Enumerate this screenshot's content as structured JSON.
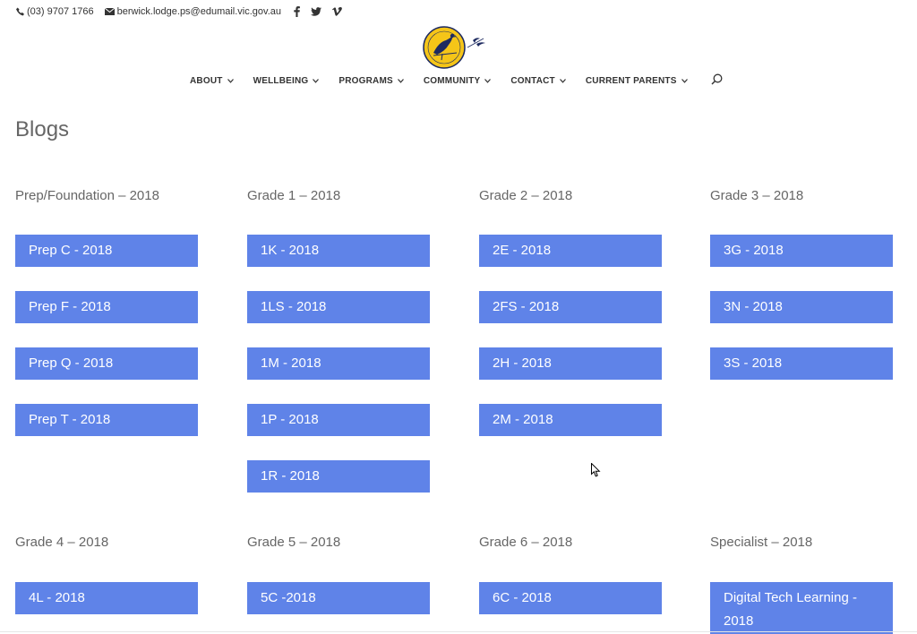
{
  "topbar": {
    "phone": "(03) 9707 1766",
    "email": "berwick.lodge.ps@edumail.vic.gov.au",
    "social": [
      "facebook-icon",
      "twitter-icon",
      "vimeo-icon"
    ]
  },
  "nav": {
    "items": [
      "ABOUT",
      "WELLBEING",
      "PROGRAMS",
      "COMMUNITY",
      "CONTACT",
      "CURRENT PARENTS"
    ]
  },
  "page": {
    "title": "Blogs"
  },
  "sections": [
    {
      "title": "Prep/Foundation – 2018",
      "buttons": [
        "Prep C - 2018",
        "Prep F - 2018",
        "Prep Q - 2018",
        "Prep T - 2018"
      ]
    },
    {
      "title": "Grade 1 – 2018",
      "buttons": [
        "1K - 2018",
        "1LS - 2018",
        "1M - 2018",
        "1P - 2018",
        "1R - 2018"
      ]
    },
    {
      "title": "Grade 2 – 2018",
      "buttons": [
        "2E - 2018",
        "2FS - 2018",
        "2H - 2018",
        "2M - 2018"
      ]
    },
    {
      "title": "Grade 3 – 2018",
      "buttons": [
        "3G - 2018",
        "3N - 2018",
        "3S - 2018"
      ]
    },
    {
      "title": "Grade 4 – 2018",
      "buttons": [
        "4L - 2018"
      ]
    },
    {
      "title": "Grade 5 – 2018",
      "buttons": [
        "5C -2018"
      ]
    },
    {
      "title": "Grade 6 – 2018",
      "buttons": [
        "6C - 2018"
      ]
    },
    {
      "title": "Specialist – 2018",
      "buttons": [
        "Digital Tech Learning - 2018"
      ]
    }
  ],
  "colors": {
    "button": "#5f83e8",
    "logo_circle": "#f5c518",
    "text": "#666666"
  }
}
